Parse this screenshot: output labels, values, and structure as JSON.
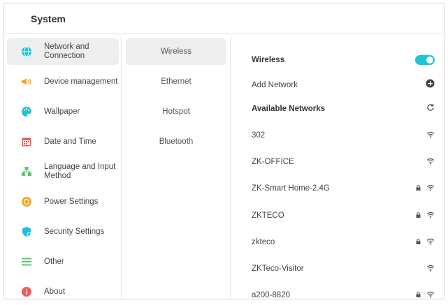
{
  "header": {
    "title": "System"
  },
  "sidebar": {
    "items": [
      {
        "label": "Network and Connection",
        "icon": "globe-icon",
        "color": "#1ec2d8"
      },
      {
        "label": "Device management",
        "icon": "speaker-icon",
        "color": "#f5a623"
      },
      {
        "label": "Wallpaper",
        "icon": "palette-icon",
        "color": "#1ec2d8"
      },
      {
        "label": "Date and Time",
        "icon": "calendar-icon",
        "color": "#f05a5a"
      },
      {
        "label": "Language and Input Method",
        "icon": "language-icon",
        "color": "#58c96b"
      },
      {
        "label": "Power Settings",
        "icon": "power-icon",
        "color": "#f5a623"
      },
      {
        "label": "Security Settings",
        "icon": "shield-icon",
        "color": "#1ec2d8"
      },
      {
        "label": "Other",
        "icon": "list-icon",
        "color": "#58c96b"
      },
      {
        "label": "About",
        "icon": "info-icon",
        "color": "#f05a5a"
      }
    ]
  },
  "subnav": {
    "items": [
      {
        "label": "Wireless"
      },
      {
        "label": "Ethernet"
      },
      {
        "label": "Hotspot"
      },
      {
        "label": "Bluetooth"
      }
    ]
  },
  "wireless": {
    "toggle_label": "Wireless",
    "toggle_on": true,
    "add_network_label": "Add Network",
    "available_label": "Available Networks",
    "networks": [
      {
        "ssid": "302",
        "locked": false
      },
      {
        "ssid": "ZK-OFFICE",
        "locked": false
      },
      {
        "ssid": "ZK-Smart Home-2.4G",
        "locked": true
      },
      {
        "ssid": "ZKTECO",
        "locked": true
      },
      {
        "ssid": "zkteco",
        "locked": true
      },
      {
        "ssid": "ZKTeco-Visitor",
        "locked": false
      },
      {
        "ssid": "a200-8820",
        "locked": true
      }
    ]
  },
  "colors": {
    "accent": "#1fc5d6"
  }
}
